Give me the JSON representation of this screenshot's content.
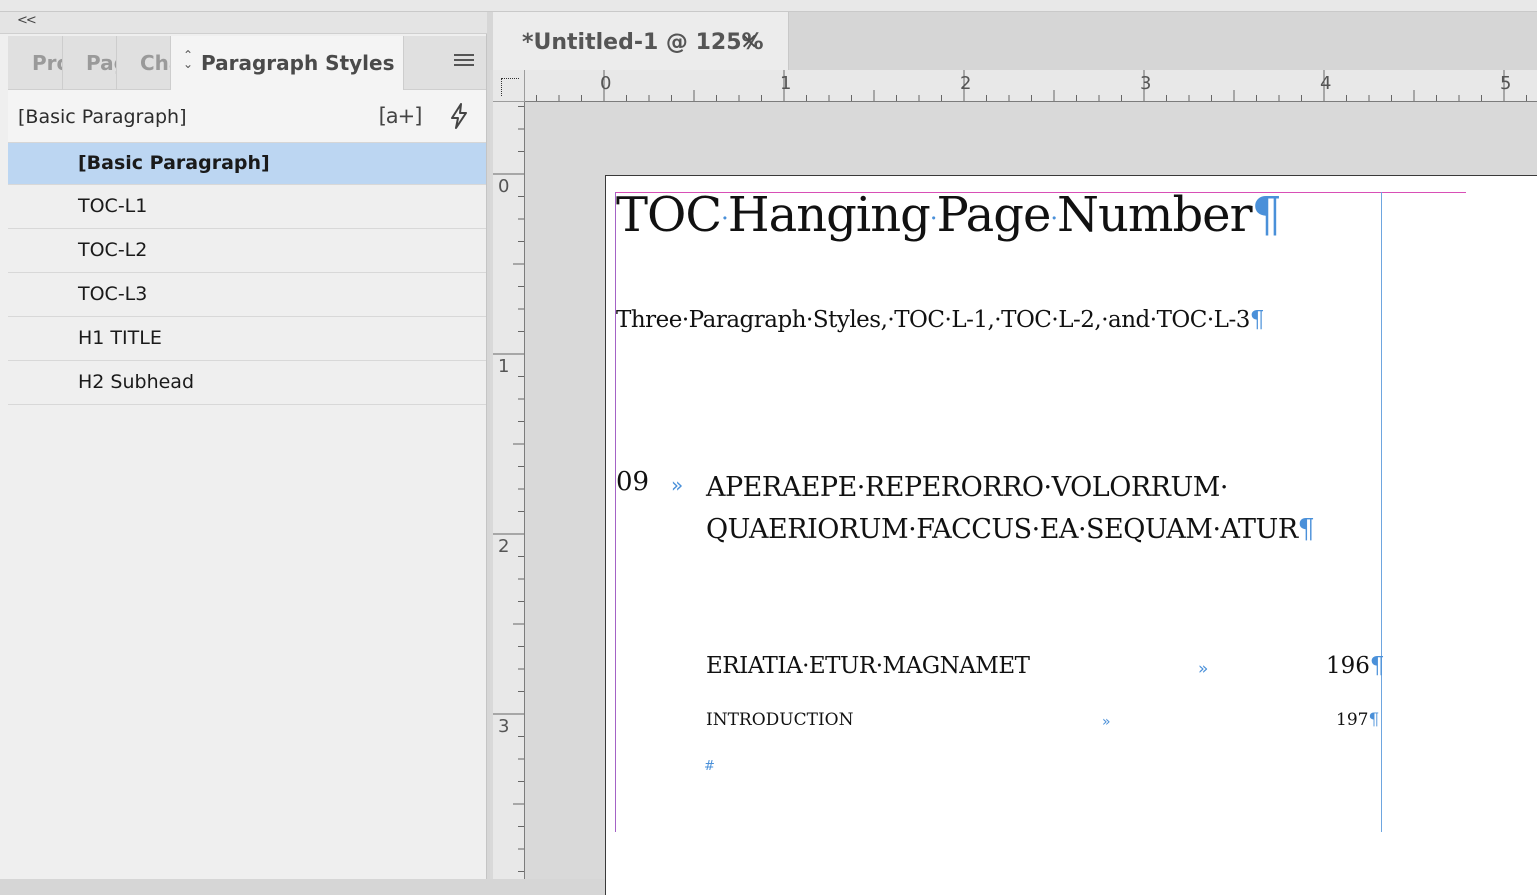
{
  "panel": {
    "collapse_glyph": "<<",
    "tabs": [
      {
        "label": "Pro"
      },
      {
        "label": "Pag"
      },
      {
        "label": "Cha"
      }
    ],
    "active_tab": {
      "label": "Paragraph Styles",
      "updown_glyph": "⌃⌄"
    },
    "current_style": "[Basic Paragraph]",
    "new_style_icon": "a-plus",
    "new_style_glyph": "[a+]",
    "quick_apply_icon": "lightning-bolt",
    "styles": [
      {
        "label": "[Basic Paragraph]",
        "selected": true
      },
      {
        "label": "TOC-L1",
        "selected": false
      },
      {
        "label": "TOC-L2",
        "selected": false
      },
      {
        "label": "TOC-L3",
        "selected": false
      },
      {
        "label": "H1 TITLE",
        "selected": false
      },
      {
        "label": "H2 Subhead",
        "selected": false
      }
    ],
    "selected_color": "#bcd6f2"
  },
  "document": {
    "tab_title": "*Untitled-1 @ 125%",
    "close_glyph": "×",
    "hruler_labels": [
      "0",
      "1",
      "2",
      "3",
      "4",
      "5"
    ],
    "vruler_labels": [
      "0",
      "1",
      "2",
      "3"
    ],
    "invisibles_color": "#4a90d9",
    "margin_color": "#d84fb6",
    "content": {
      "h1": [
        "TOC",
        "Hanging",
        "Page",
        "Number"
      ],
      "h2": "Three·Paragraph·Styles,·TOC·L-1,·TOC·L-2,·and·TOC·L-3",
      "toc1_number": "09",
      "toc1_line1": "APERAEPE·REPERORRO·VOLORRUM·",
      "toc1_line2": "QUAERIORUM·FACCUS·EA·SEQUAM·ATUR",
      "toc2_text": "ERIATIA·ETUR·MAGNAMET",
      "toc2_number": "196",
      "toc3_text": "INTRODUCTION",
      "toc3_number": "197",
      "tab_glyph": "»",
      "pilcrow": "¶",
      "end_of_story": "#"
    }
  }
}
